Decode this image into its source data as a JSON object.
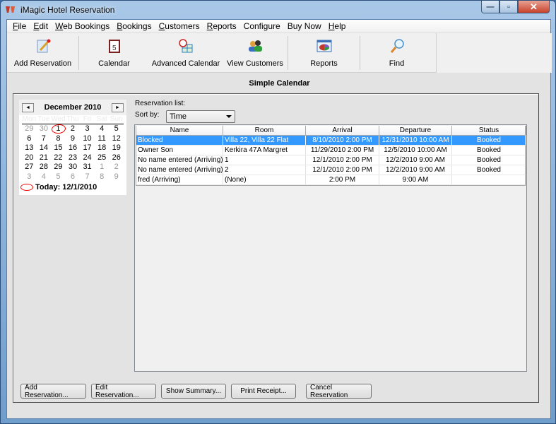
{
  "window": {
    "title": "iMagic Hotel Reservation",
    "minimize": "—",
    "maximize": "▫",
    "close": "✕"
  },
  "menu": [
    {
      "label": "File",
      "accel": "F",
      "rest": "ile"
    },
    {
      "label": "Edit",
      "accel": "E",
      "rest": "dit"
    },
    {
      "label": "Web Bookings",
      "accel": "W",
      "rest": "eb Bookings"
    },
    {
      "label": "Bookings",
      "accel": "B",
      "rest": "ookings"
    },
    {
      "label": "Customers",
      "accel": "C",
      "rest": "ustomers"
    },
    {
      "label": "Reports",
      "accel": "R",
      "rest": "eports"
    },
    {
      "label": "Configure",
      "accel": "",
      "rest": "Configure"
    },
    {
      "label": "Buy Now",
      "accel": "",
      "rest": "Buy Now"
    },
    {
      "label": "Help",
      "accel": "H",
      "rest": "elp"
    }
  ],
  "toolbar": {
    "add_reservation": "Add Reservation",
    "calendar": "Calendar",
    "advanced_calendar": "Advanced Calendar",
    "view_customers": "View Customers",
    "reports": "Reports",
    "find": "Find"
  },
  "section_title": "Simple Calendar",
  "calendar": {
    "month": "December 2010",
    "prev": "◄",
    "next": "►",
    "dow": [
      "Mon",
      "Tue",
      "Wed",
      "Thu",
      "Fri",
      "Sat",
      "Sun"
    ],
    "days": [
      {
        "d": "29",
        "dim": true
      },
      {
        "d": "30",
        "dim": true
      },
      {
        "d": "1",
        "sel": true
      },
      {
        "d": "2"
      },
      {
        "d": "3"
      },
      {
        "d": "4"
      },
      {
        "d": "5"
      },
      {
        "d": "6"
      },
      {
        "d": "7"
      },
      {
        "d": "8"
      },
      {
        "d": "9"
      },
      {
        "d": "10"
      },
      {
        "d": "11"
      },
      {
        "d": "12"
      },
      {
        "d": "13"
      },
      {
        "d": "14"
      },
      {
        "d": "15"
      },
      {
        "d": "16"
      },
      {
        "d": "17"
      },
      {
        "d": "18"
      },
      {
        "d": "19"
      },
      {
        "d": "20"
      },
      {
        "d": "21"
      },
      {
        "d": "22"
      },
      {
        "d": "23"
      },
      {
        "d": "24"
      },
      {
        "d": "25"
      },
      {
        "d": "26"
      },
      {
        "d": "27"
      },
      {
        "d": "28"
      },
      {
        "d": "29"
      },
      {
        "d": "30"
      },
      {
        "d": "31"
      },
      {
        "d": "1",
        "dim": true
      },
      {
        "d": "2",
        "dim": true
      },
      {
        "d": "3",
        "dim": true
      },
      {
        "d": "4",
        "dim": true
      },
      {
        "d": "5",
        "dim": true
      },
      {
        "d": "6",
        "dim": true
      },
      {
        "d": "7",
        "dim": true
      },
      {
        "d": "8",
        "dim": true
      },
      {
        "d": "9",
        "dim": true
      }
    ],
    "today": "Today: 12/1/2010"
  },
  "reservation_list_label": "Reservation list:",
  "sort": {
    "label": "Sort by:",
    "value": "Time"
  },
  "table": {
    "columns": [
      "Name",
      "Room",
      "Arrival",
      "Departure",
      "Status"
    ],
    "rows": [
      {
        "name": "Blocked",
        "room": "Villa 22, Villa 22 Flat",
        "arrival": "8/10/2010 2:00 PM",
        "departure": "12/31/2010 10:00 AM",
        "status": "Booked",
        "selected": true
      },
      {
        "name": "Owner Son",
        "room": "Kerkira 47A Margret",
        "arrival": "11/29/2010 2:00 PM",
        "departure": "12/5/2010 10:00 AM",
        "status": "Booked"
      },
      {
        "name": "No name entered (Arriving)",
        "room": "1",
        "arrival": "12/1/2010 2:00 PM",
        "departure": "12/2/2010 9:00 AM",
        "status": "Booked"
      },
      {
        "name": "No name entered (Arriving)",
        "room": "2",
        "arrival": "12/1/2010 2:00 PM",
        "departure": "12/2/2010 9:00 AM",
        "status": "Booked"
      },
      {
        "name": "fred  (Arriving)",
        "room": "(None)",
        "arrival": "2:00 PM",
        "departure": "9:00 AM",
        "status": ""
      }
    ]
  },
  "buttons": {
    "add": "Add Reservation...",
    "edit": "Edit Reservation...",
    "summary": "Show Summary...",
    "print": "Print Receipt...",
    "cancel": "Cancel Reservation"
  }
}
